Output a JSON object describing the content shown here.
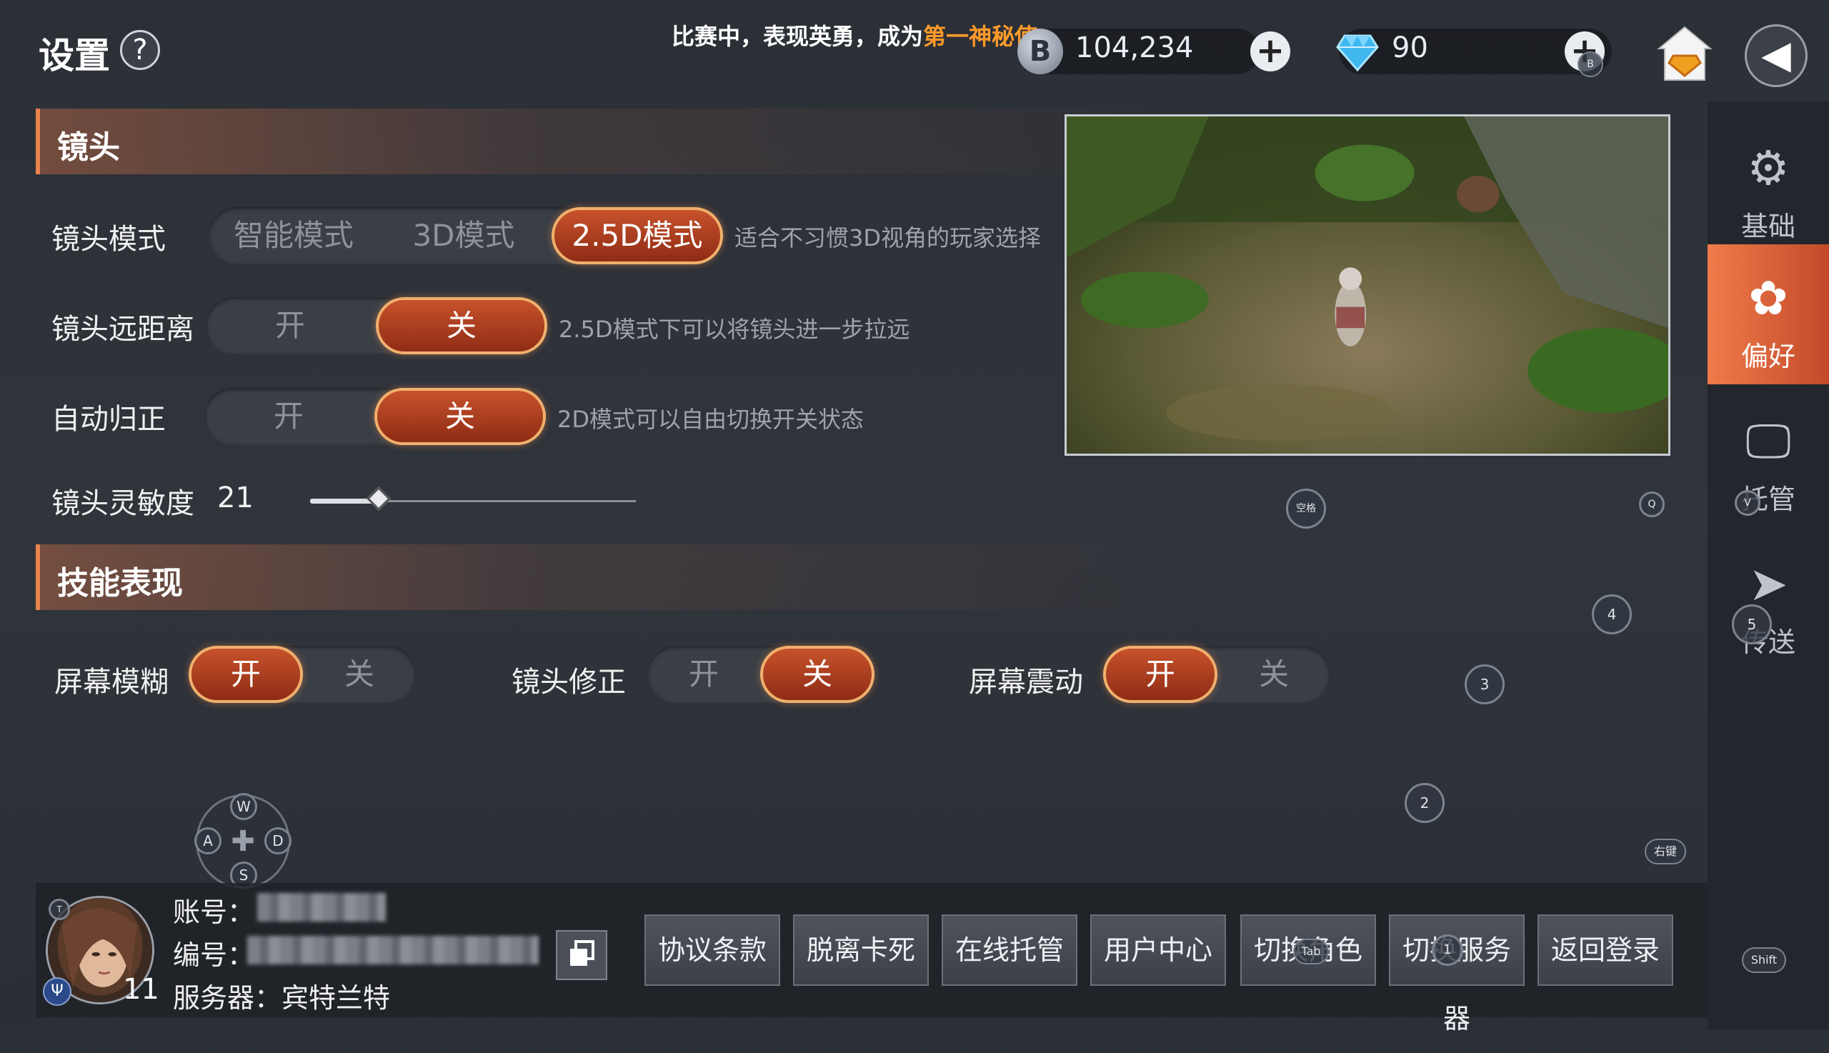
{
  "header": {
    "title": "设置",
    "help_icon": "?",
    "marquee_prefix": "比赛中，表现英勇，成为",
    "marquee_highlight": "第一神秘使",
    "marquee_suffix": "。",
    "coin_symbol": "B",
    "coins": "104,234",
    "gems": "90",
    "plus_symbol": "+",
    "back_symbol": "◀"
  },
  "sidebar": {
    "items": [
      {
        "label": "基础",
        "icon": "gear-icon"
      },
      {
        "label": "偏好",
        "icon": "preference-icon"
      },
      {
        "label": "托管",
        "icon": "monitor-icon"
      },
      {
        "label": "传送",
        "icon": "send-icon"
      }
    ],
    "active": "偏好"
  },
  "camera": {
    "section_title": "镜头",
    "mode": {
      "label": "镜头模式",
      "options": [
        "智能模式",
        "3D模式",
        "2.5D模式"
      ],
      "selected": "2.5D模式",
      "hint": "适合不习惯3D视角的玩家选择"
    },
    "distance": {
      "label": "镜头远距离",
      "on": "开",
      "off": "关",
      "selected": "关",
      "hint": "2.5D模式下可以将镜头进一步拉远"
    },
    "auto_reset": {
      "label": "自动归正",
      "on": "开",
      "off": "关",
      "selected": "关",
      "hint": "2D模式可以自由切换开关状态"
    },
    "sensitivity": {
      "label": "镜头灵敏度",
      "value": "21",
      "fraction": 0.21
    }
  },
  "skill": {
    "section_title": "技能表现",
    "blur": {
      "label": "屏幕模糊",
      "on": "开",
      "off": "关",
      "selected": "开"
    },
    "correction": {
      "label": "镜头修正",
      "on": "开",
      "off": "关",
      "selected": "关"
    },
    "shake": {
      "label": "屏幕震动",
      "on": "开",
      "off": "关",
      "selected": "开"
    }
  },
  "key_hints": {
    "space": "空格",
    "q": "Q",
    "v": "V",
    "k4": "4",
    "k5": "5",
    "k3": "3",
    "k2": "2",
    "right_click": "右键",
    "shift": "Shift",
    "tab": "Tab",
    "k1": "1",
    "t": "T",
    "w": "W",
    "a": "A",
    "s": "S",
    "d": "D"
  },
  "account": {
    "account_label": "账号：",
    "id_label": "编号：",
    "server_label": "服务器：",
    "server_name": "宾特兰特",
    "level": "11"
  },
  "buttons": [
    "协议条款",
    "脱离卡死",
    "在线托管",
    "用户中心",
    "切换角色",
    "切换服务器",
    "返回登录"
  ],
  "colors": {
    "accent": "#e8834d",
    "selected": "#c7522b",
    "highlight_text": "#ff9a2a"
  }
}
